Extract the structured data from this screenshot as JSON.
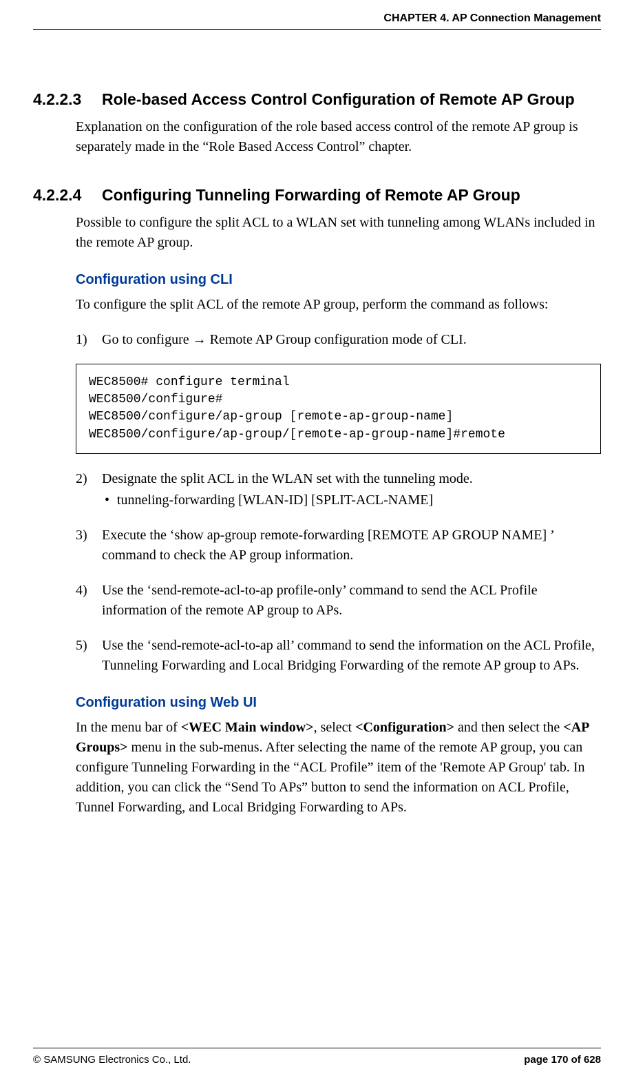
{
  "header": {
    "chapter": "CHAPTER 4. AP Connection Management"
  },
  "sections": {
    "s4223": {
      "num": "4.2.2.3",
      "title": "Role-based Access Control Configuration of Remote AP Group",
      "body": "Explanation on the configuration of the role based access control of the remote AP group is separately made in the “Role Based Access Control” chapter."
    },
    "s4224": {
      "num": "4.2.2.4",
      "title": "Configuring Tunneling Forwarding of Remote AP Group",
      "body": "Possible to configure the split ACL to a WLAN set with tunneling among WLANs included in the remote AP group.",
      "cli": {
        "heading": "Configuration using CLI",
        "intro": "To configure the split ACL of the remote AP group, perform the command as follows:",
        "steps": {
          "s1_num": "1)",
          "s1": "Go to configure → Remote AP Group configuration mode of CLI.",
          "code": "WEC8500# configure terminal\nWEC8500/configure#\nWEC8500/configure/ap-group [remote-ap-group-name]\nWEC8500/configure/ap-group/[remote-ap-group-name]#remote",
          "s2_num": "2)",
          "s2": "Designate the split ACL in the WLAN set with the tunneling mode.",
          "s2_bullet": "tunneling-forwarding [WLAN-ID] [SPLIT-ACL-NAME]",
          "s3_num": "3)",
          "s3": "Execute the ‘show ap-group remote-forwarding [REMOTE AP GROUP NAME] ’ command to check the AP group information.",
          "s4_num": "4)",
          "s4": "Use the ‘send-remote-acl-to-ap profile-only’ command to send the ACL Profile information of the remote AP group to APs.",
          "s5_num": "5)",
          "s5": "Use the ‘send-remote-acl-to-ap all’ command to send the information on the ACL Profile, Tunneling Forwarding and Local Bridging Forwarding of the remote AP group to APs."
        }
      },
      "webui": {
        "heading": "Configuration using Web UI",
        "part1": "In the menu bar of ",
        "bold1": "<WEC Main window>",
        "part2": ", select ",
        "bold2": "<Configuration>",
        "part3": " and then select the ",
        "bold3": "<AP Groups>",
        "part4": " menu in the sub-menus. After selecting the name of the remote AP group, you can configure Tunneling Forwarding in the “ACL Profile” item of the 'Remote AP Group' tab. In addition, you can click the “Send To APs” button to send the information on ACL Profile, Tunnel Forwarding, and Local Bridging Forwarding to APs."
      }
    }
  },
  "footer": {
    "copyright": "© SAMSUNG Electronics Co., Ltd.",
    "page": "page 170 of 628"
  }
}
